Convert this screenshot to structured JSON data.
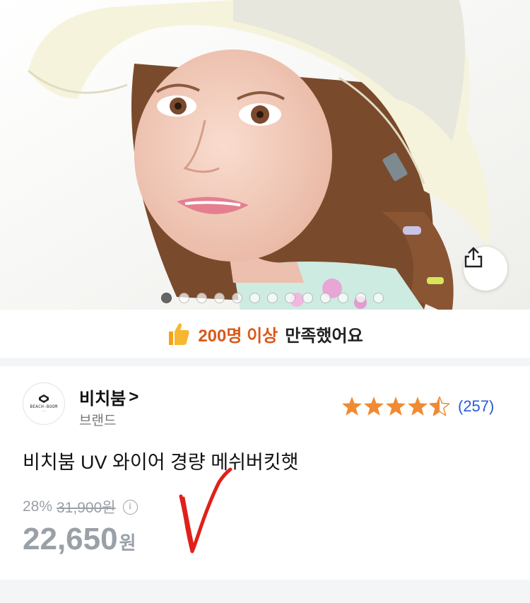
{
  "hero": {
    "image_desc_icon": "product-photo",
    "carousel_total": 13,
    "carousel_active": 1
  },
  "satisfaction": {
    "icon": "thumbs-up-icon",
    "count_text": "200명 이상",
    "rest_text": "만족했어요"
  },
  "brand": {
    "logo_text": "BEACH-BOOM",
    "name": "비치붐",
    "chevron": ">",
    "sub": "브랜드"
  },
  "rating": {
    "stars": 4.5,
    "review_count": "(257)"
  },
  "product": {
    "title": "비치붐 UV 와이어 경량 메쉬버킷햇"
  },
  "price": {
    "discount": "28%",
    "original": "31,900원",
    "info_icon": "i",
    "sale_amount": "22,650",
    "sale_unit": "원"
  },
  "colors": {
    "accent_orange": "#d9591a",
    "star_orange": "#f08a33",
    "link_blue": "#2a5bd7",
    "muted_gray": "#9aa0a8",
    "annotation_red": "#e0201a"
  }
}
